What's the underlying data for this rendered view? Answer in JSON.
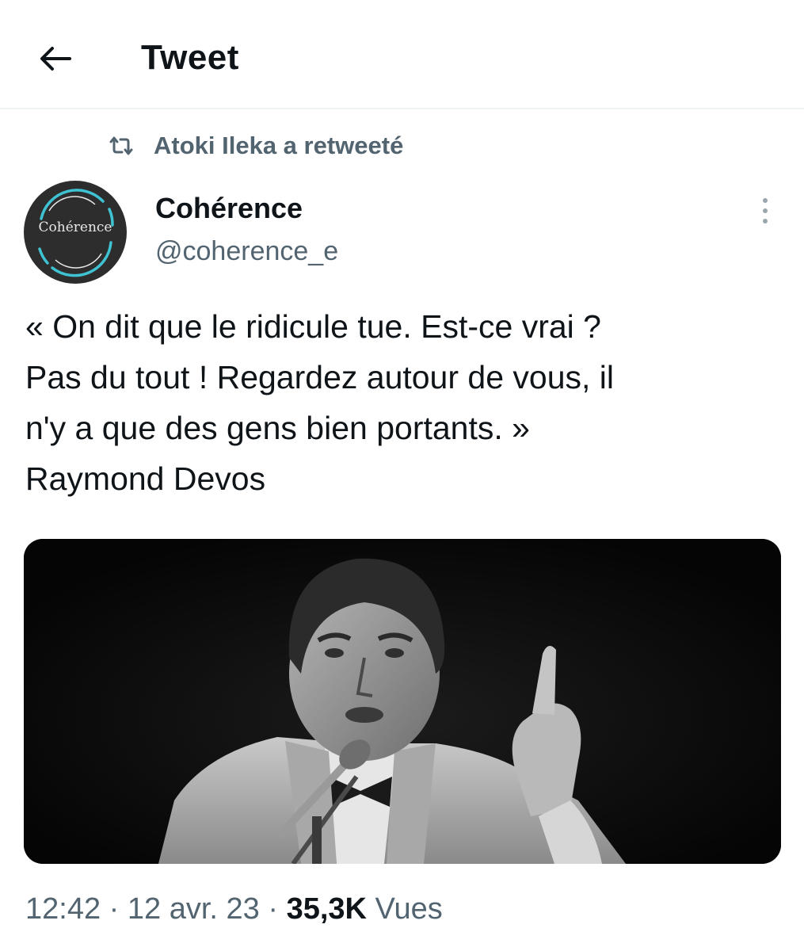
{
  "header": {
    "title": "Tweet",
    "back_icon": "arrow-left-icon"
  },
  "social_context": {
    "icon": "retweet-icon",
    "text": "Atoki Ileka a retweeté"
  },
  "author": {
    "avatar_text": "Cohérence",
    "display_name": "Cohérence",
    "handle": "@coherence_e"
  },
  "tweet": {
    "text": "« On dit que le ridicule tue. Est-ce vrai ?\nPas du tout ! Regardez autour de vous, il\nn'y a que des gens bien portants. »\nRaymond Devos"
  },
  "metadata": {
    "time": "12:42",
    "separator": "·",
    "date": "12 avr. 23",
    "views_count": "35,3K",
    "views_label": "Vues"
  },
  "colors": {
    "text_primary": "#0f1419",
    "text_secondary": "#536471",
    "divider": "#eff3f4",
    "avatar_bg": "#2d2d2d",
    "avatar_ring": "#3fc3d3"
  }
}
